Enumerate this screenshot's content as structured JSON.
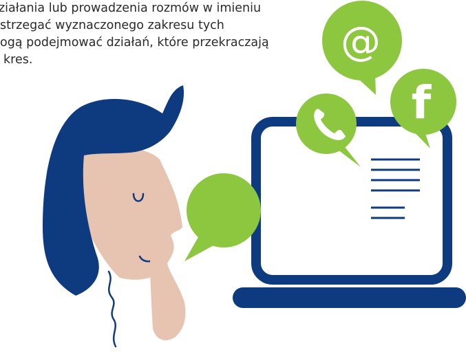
{
  "text": {
    "lines": [
      "ziałania lub prowadzenia rozmów w imieniu",
      "strzegać wyznaczonego zakresu tych",
      "ogą podejmować działań, które przekraczają",
      "kres."
    ]
  },
  "colors": {
    "navy": "#0e3a7f",
    "green": "#8dc63f",
    "skin": "#e6c4b1",
    "text": "#2a2a2a",
    "white": "#ffffff"
  },
  "icons": {
    "email": "at-sign-icon",
    "phone": "phone-icon",
    "facebook": "facebook-icon",
    "chat": "speech-bubble-icon",
    "laptop": "laptop-icon",
    "person": "person-illustration"
  },
  "bubbles": {
    "email_symbol": "@",
    "facebook_symbol": "f"
  }
}
